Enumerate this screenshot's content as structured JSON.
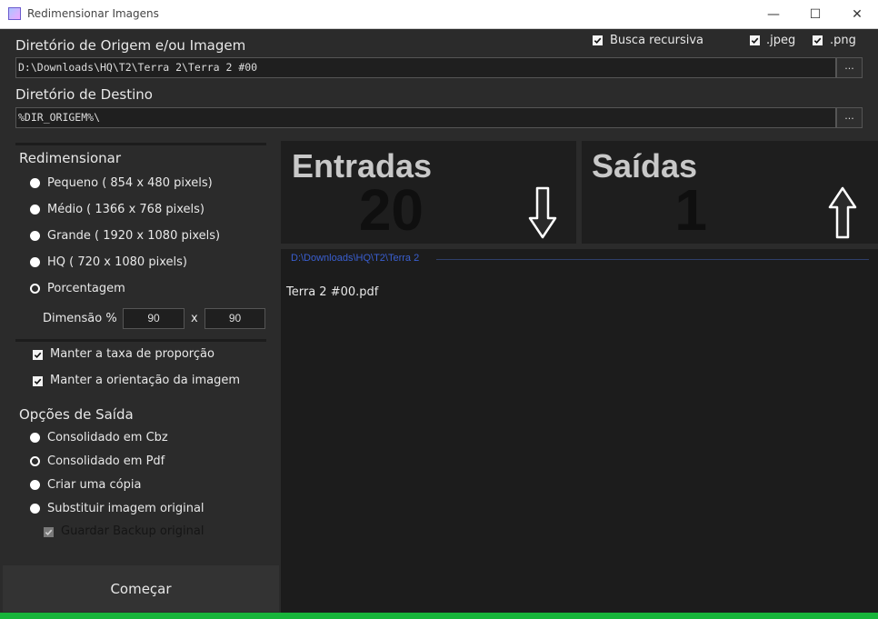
{
  "window": {
    "title": "Redimensionar Imagens",
    "minimize": "—",
    "maximize": "☐",
    "close": "✕"
  },
  "source": {
    "label": "Diretório de Origem e/ou Imagem",
    "value": "D:\\Downloads\\HQ\\T2\\Terra 2\\Terra 2 #00",
    "browse": "..."
  },
  "dest": {
    "label": "Diretório de Destino",
    "value": "%DIR_ORIGEM%\\",
    "browse": "..."
  },
  "options": {
    "recursive": "Busca recursiva",
    "jpeg": ".jpeg",
    "png": ".png"
  },
  "resize": {
    "title": "Redimensionar",
    "items": [
      "Pequeno ( 854 x 480 pixels)",
      "Médio ( 1366 x 768 pixels)",
      "Grande ( 1920 x 1080 pixels)",
      "HQ ( 720 x 1080 pixels)",
      "Porcentagem"
    ],
    "dimension_label": "Dimensão %",
    "width": "90",
    "x_label": "x",
    "height": "90"
  },
  "keep_ratio": "Manter a taxa de proporção",
  "keep_orientation": "Manter a orientação da imagem",
  "output": {
    "title": "Opções de Saída",
    "items": [
      "Consolidado em Cbz",
      "Consolidado em Pdf",
      "Criar uma cópia",
      "Substituir imagem original"
    ],
    "backup": "Guardar Backup original"
  },
  "start": "Começar",
  "stats": {
    "in_title": "Entradas",
    "in_count": "20",
    "out_title": "Saídas",
    "out_count": "1"
  },
  "list": {
    "path": "D:\\Downloads\\HQ\\T2\\Terra 2",
    "file": "Terra 2 #00.pdf"
  }
}
